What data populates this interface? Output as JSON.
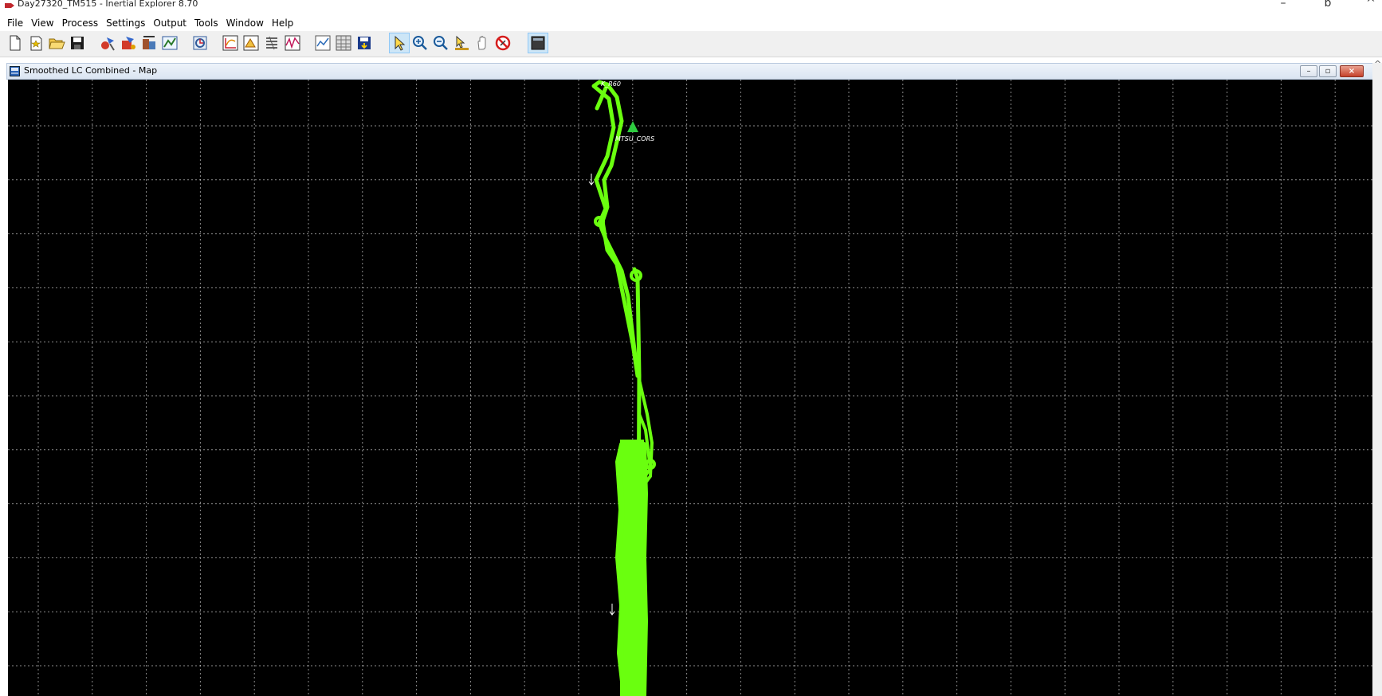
{
  "window": {
    "title": "Day27320_TM515 - Inertial Explorer 8.70",
    "minimize_glyph": "–",
    "restore_glyph": "ɒ",
    "close_glyph": "^"
  },
  "menu": [
    "File",
    "View",
    "Process",
    "Settings",
    "Output",
    "Tools",
    "Window",
    "Help"
  ],
  "toolbar_icons": [
    "new-file-icon",
    "new-project-icon",
    "open-folder-icon",
    "save-icon",
    "process-gnss-icon",
    "process-ins-icon",
    "combine-icon",
    "map-tools-icon",
    "convert-icon",
    "plot-icon",
    "plot-multi-icon",
    "list-icon",
    "graph-icon",
    "chart-icon",
    "grid-icon",
    "export-icon",
    "select-pointer-icon",
    "zoom-in-icon",
    "zoom-out-icon",
    "measure-icon",
    "pan-hand-icon",
    "no-entry-icon",
    "display-icon"
  ],
  "child_window": {
    "title": "Smoothed LC Combined - Map",
    "minimize_glyph": "–",
    "maximize_glyph": "▫",
    "close_glyph": "×"
  },
  "map": {
    "background": "#000000",
    "grid_color": "#ffffff",
    "track_color": "#6aff0f",
    "station_color": "#2ecc40",
    "label_start": "K_R60",
    "label_station": "MTSU_CORS"
  },
  "scroll_up_glyph": "^"
}
